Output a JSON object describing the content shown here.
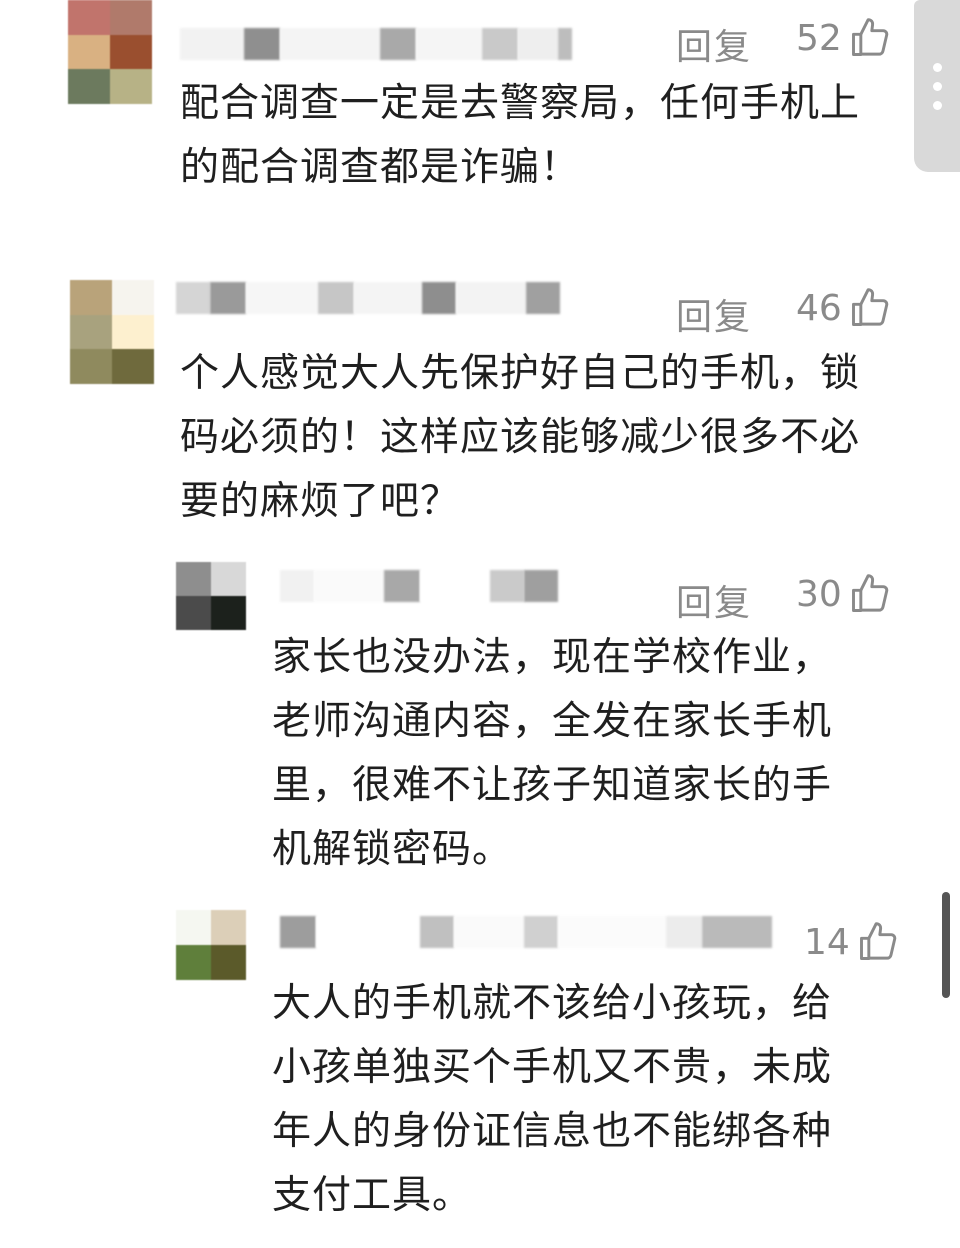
{
  "comments": [
    {
      "reply_label": "回复",
      "likes": "52",
      "text_lines": [
        "配合调查一定是去警察局，任何手机上",
        "的配合调查都是诈骗！"
      ]
    },
    {
      "reply_label": "回复",
      "likes": "46",
      "text_lines": [
        "个人感觉大人先保护好自己的手机，锁",
        "码必须的！这样应该能够减少很多不必",
        "要的麻烦了吧？"
      ]
    },
    {
      "reply_label": "回复",
      "likes": "30",
      "text_lines": [
        "家长也没办法，现在学校作业，",
        "老师沟通内容，全发在家长手机",
        "里，很难不让孩子知道家长的手",
        "机解锁密码。"
      ]
    },
    {
      "likes": "14",
      "text_lines": [
        "大人的手机就不该给小孩玩，给",
        "小孩单独买个手机又不贵，未成",
        "年人的身份证信息也不能绑各种",
        "支付工具。"
      ]
    }
  ],
  "icons": {
    "like": "thumbs-up-icon",
    "more": "more-vertical-icon"
  },
  "colors": {
    "text": "#1f1f1f",
    "meta": "#8a8a8a",
    "background": "#ffffff"
  }
}
